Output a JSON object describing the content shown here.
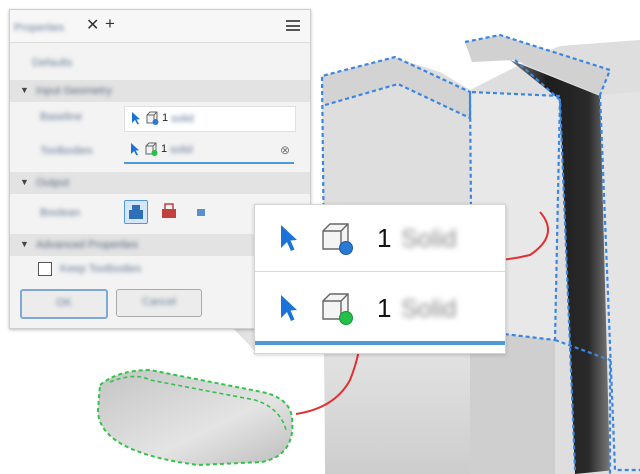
{
  "panel": {
    "tab_title": "Properties",
    "close_glyph": "✕",
    "add_glyph": "+",
    "menu_icon": "hamburger-menu-icon",
    "toolbar_label": "Defaults",
    "sections": {
      "input": {
        "title": "Input Geometry",
        "arrow": "▼"
      },
      "output": {
        "title": "Output",
        "arrow": "▼"
      },
      "advanced": {
        "title": "Advanced Properties",
        "arrow": "▼"
      }
    },
    "rows": {
      "baseline": {
        "label": "Baseline",
        "count": "1",
        "kind": "solid"
      },
      "toolbodies": {
        "label": "Toolbodies",
        "count": "1",
        "kind": "solid"
      }
    },
    "output_label": "Boolean",
    "keep_toolbodies": "Keep Toolbodies",
    "ok_label": "OK",
    "cancel_label": "Cancel"
  },
  "callout": {
    "row1": {
      "count": "1",
      "kind": "Solid"
    },
    "row2": {
      "count": "1",
      "kind": "Solid"
    }
  },
  "colors": {
    "accent_blue": "#4f9ad6",
    "select_arrow": "#1a73d9",
    "baseline_marker": "#2979d6",
    "toolbody_marker": "#22c24a",
    "connector": "#e03030",
    "baseline_edges": "#3a86e0",
    "toolbody_edges": "#33c24a"
  }
}
